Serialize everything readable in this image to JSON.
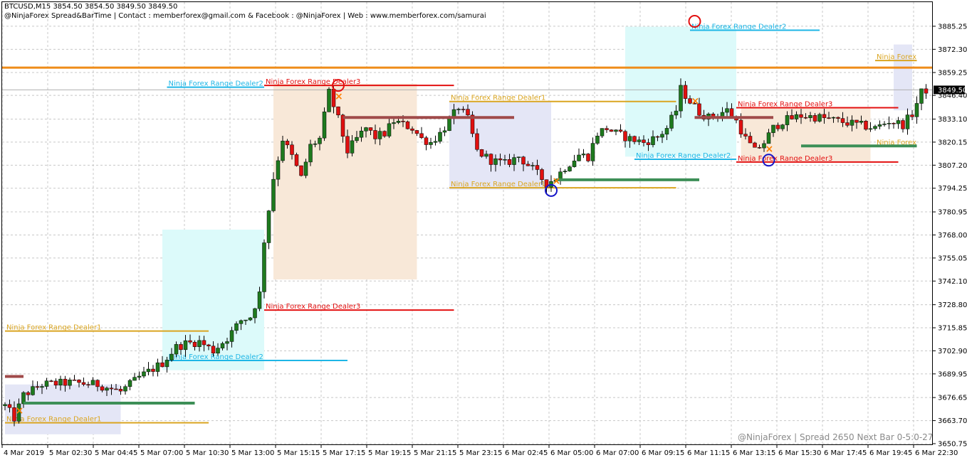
{
  "header": {
    "symbol_line": "BTCUSD,M15  3854.50 3854.50 3849.50 3849.50",
    "contact_line": "@NinjaForex Spread&BarTime | Contact : memberforex@gmail.com & Facebook : @NinjaForex | Web : www.memberforex.com/samurai"
  },
  "footer": "@NinjaForex | Spread 2650 Next Bar 0-5:0-27",
  "current_price_label": "3849.50",
  "colors": {
    "bull": "#1e7a1e",
    "bear": "#e01010",
    "dealer1": "#daa520",
    "dealer2": "#1eb6e6",
    "dealer3": "#e31010",
    "hline": "#ef8c19",
    "mean_green": "#3d8f57",
    "mean_brown": "#a04a4a"
  },
  "chart_data": {
    "type": "candlestick",
    "symbol": "BTCUSD",
    "timeframe": "M15",
    "ylim": [
      3650.75,
      3898.0
    ],
    "y_ticks": [
      "3885.25",
      "3872.30",
      "3859.25",
      "3846.40",
      "3833.10",
      "3820.15",
      "3807.20",
      "3794.25",
      "3780.95",
      "3768.00",
      "3755.05",
      "3742.10",
      "3728.80",
      "3715.85",
      "3702.90",
      "3689.95",
      "3676.65",
      "3663.70",
      "3650.75"
    ],
    "x_ticks": [
      "4 Mar 2019",
      "5 Mar 02:30",
      "5 Mar 04:45",
      "5 Mar 07:00",
      "5 Mar 10:30",
      "5 Mar 13:00",
      "5 Mar 15:15",
      "5 Mar 17:15",
      "5 Mar 19:15",
      "5 Mar 21:15",
      "5 Mar 23:15",
      "6 Mar 02:45",
      "6 Mar 05:00",
      "6 Mar 07:00",
      "6 Mar 09:15",
      "6 Mar 11:15",
      "6 Mar 13:15",
      "6 Mar 15:30",
      "6 Mar 17:45",
      "6 Mar 19:45",
      "6 Mar 22:30"
    ],
    "bar_count": 200,
    "anchors": [
      [
        0,
        3672
      ],
      [
        2,
        3665
      ],
      [
        4,
        3678
      ],
      [
        8,
        3684
      ],
      [
        14,
        3685
      ],
      [
        20,
        3684
      ],
      [
        25,
        3680
      ],
      [
        29,
        3688
      ],
      [
        34,
        3696
      ],
      [
        37,
        3705
      ],
      [
        39,
        3707
      ],
      [
        42,
        3708
      ],
      [
        45,
        3703
      ],
      [
        48,
        3710
      ],
      [
        51,
        3720
      ],
      [
        53,
        3722
      ],
      [
        55,
        3735
      ],
      [
        56,
        3765
      ],
      [
        58,
        3800
      ],
      [
        60,
        3822
      ],
      [
        62,
        3812
      ],
      [
        64,
        3800
      ],
      [
        66,
        3818
      ],
      [
        68,
        3822
      ],
      [
        70,
        3848
      ],
      [
        72,
        3833
      ],
      [
        74,
        3815
      ],
      [
        76,
        3822
      ],
      [
        78,
        3828
      ],
      [
        80,
        3823
      ],
      [
        82,
        3825
      ],
      [
        84,
        3832
      ],
      [
        86,
        3830
      ],
      [
        88,
        3828
      ],
      [
        90,
        3822
      ],
      [
        92,
        3820
      ],
      [
        94,
        3825
      ],
      [
        96,
        3832
      ],
      [
        98,
        3840
      ],
      [
        100,
        3833
      ],
      [
        102,
        3815
      ],
      [
        105,
        3810
      ],
      [
        108,
        3808
      ],
      [
        111,
        3812
      ],
      [
        114,
        3805
      ],
      [
        117,
        3797
      ],
      [
        119,
        3800
      ],
      [
        121,
        3806
      ],
      [
        124,
        3813
      ],
      [
        126,
        3812
      ],
      [
        128,
        3825
      ],
      [
        130,
        3828
      ],
      [
        132,
        3825
      ],
      [
        135,
        3822
      ],
      [
        138,
        3820
      ],
      [
        141,
        3823
      ],
      [
        143,
        3828
      ],
      [
        145,
        3838
      ],
      [
        146,
        3850
      ],
      [
        148,
        3843
      ],
      [
        150,
        3837
      ],
      [
        152,
        3834
      ],
      [
        154,
        3836
      ],
      [
        156,
        3838
      ],
      [
        158,
        3832
      ],
      [
        160,
        3822
      ],
      [
        162,
        3815
      ],
      [
        164,
        3820
      ],
      [
        166,
        3828
      ],
      [
        168,
        3832
      ],
      [
        172,
        3835
      ],
      [
        176,
        3834
      ],
      [
        180,
        3832
      ],
      [
        184,
        3830
      ],
      [
        188,
        3828
      ],
      [
        191,
        3832
      ],
      [
        194,
        3830
      ],
      [
        196,
        3836
      ],
      [
        198,
        3848
      ],
      [
        199,
        3849.5
      ]
    ],
    "horizontal_line": 3862.0,
    "levels": [
      {
        "label": "Ninja Forex Range Dealer1",
        "x0": 0,
        "x1": 44,
        "y": 3662.5,
        "color": "dealer1"
      },
      {
        "label": "Ninja Forex Range Dealer1",
        "x0": 0,
        "x1": 44,
        "y": 3714.0,
        "color": "dealer1"
      },
      {
        "label": "Ninja Forex Range Dealer2",
        "x0": 35,
        "x1": 74,
        "y": 3697.5,
        "color": "dealer2"
      },
      {
        "label": "Ninja Forex Range Dealer3",
        "x0": 56,
        "x1": 97,
        "y": 3725.8,
        "color": "dealer3"
      },
      {
        "label": "Ninja Forex Range Dealer2",
        "x0": 35,
        "x1": 56,
        "y": 3851.0,
        "color": "dealer2"
      },
      {
        "label": "Ninja Forex Range Dealer3",
        "x0": 56,
        "x1": 97,
        "y": 3852.0,
        "color": "dealer3"
      },
      {
        "label": "Ninja Forex Range Dealer1",
        "x0": 96,
        "x1": 145,
        "y": 3843.0,
        "color": "dealer1"
      },
      {
        "label": "Ninja Forex Range Dealer1",
        "x0": 96,
        "x1": 145,
        "y": 3794.5,
        "color": "dealer1"
      },
      {
        "label": "Ninja Forex Range Dealer2",
        "x0": 148,
        "x1": 176,
        "y": 3883.0,
        "color": "dealer2"
      },
      {
        "label": "Ninja Forex Range Dealer2",
        "x0": 136,
        "x1": 158,
        "y": 3810.5,
        "color": "dealer2"
      },
      {
        "label": "Ninja Forex Range Dealer3",
        "x0": 158,
        "x1": 193,
        "y": 3839.5,
        "color": "dealer3"
      },
      {
        "label": "Ninja Forex Range Dealer3",
        "x0": 158,
        "x1": 193,
        "y": 3809.0,
        "color": "dealer3"
      },
      {
        "label": "Ninja Forex",
        "x0": 188,
        "x1": 197,
        "y": 3866.0,
        "color": "dealer1"
      },
      {
        "label": "Ninja Forex",
        "x0": 188,
        "x1": 197,
        "y": 3818.0,
        "color": "dealer1"
      }
    ],
    "boxes": [
      {
        "x0": 0,
        "x1": 25,
        "y0": 3656.0,
        "y1": 3684.0,
        "fill": "#e4e6f6"
      },
      {
        "x0": 34,
        "x1": 56,
        "y0": 3692.0,
        "y1": 3771.0,
        "fill": "#dcfafa"
      },
      {
        "x0": 58,
        "x1": 89,
        "y0": 3743.0,
        "y1": 3853.0,
        "fill": "#f8e8d8"
      },
      {
        "x0": 96,
        "x1": 118,
        "y0": 3793.5,
        "y1": 3843.0,
        "fill": "#e4e6f6"
      },
      {
        "x0": 134,
        "x1": 158,
        "y0": 3812.0,
        "y1": 3885.0,
        "fill": "#dcfafa"
      },
      {
        "x0": 159,
        "x1": 187,
        "y0": 3809.5,
        "y1": 3839.5,
        "fill": "#f8e8d8"
      },
      {
        "x0": 192,
        "x1": 196,
        "y0": 3838.0,
        "y1": 3875.0,
        "fill": "#e4e6f6"
      }
    ],
    "mean_lines": [
      {
        "x0": 4,
        "x1": 41,
        "y": 3673.5,
        "color": "mean_green"
      },
      {
        "x0": 73,
        "x1": 110,
        "y": 3834.0,
        "color": "mean_brown"
      },
      {
        "x0": 119,
        "x1": 150,
        "y": 3799.0,
        "color": "mean_green"
      },
      {
        "x0": 149,
        "x1": 166,
        "y": 3834.0,
        "color": "mean_brown"
      },
      {
        "x0": 172,
        "x1": 197,
        "y": 3818.0,
        "color": "mean_green"
      },
      {
        "x0": 0,
        "x1": 4,
        "y": 3688.5,
        "color": "mean_brown"
      }
    ],
    "circles": [
      {
        "x": 72,
        "y": 3852.0,
        "color": "#e31010"
      },
      {
        "x": 149,
        "y": 3888.0,
        "color": "#e31010"
      },
      {
        "x": 118,
        "y": 3793.0,
        "color": "#1414c8"
      },
      {
        "x": 165,
        "y": 3810.0,
        "color": "#1414c8"
      }
    ],
    "crosses": [
      {
        "x": 3,
        "y": 3669.5
      },
      {
        "x": 72,
        "y": 3846.0
      },
      {
        "x": 149,
        "y": 3843.5
      },
      {
        "x": 119,
        "y": 3798.5
      },
      {
        "x": 165,
        "y": 3816.5
      }
    ]
  }
}
